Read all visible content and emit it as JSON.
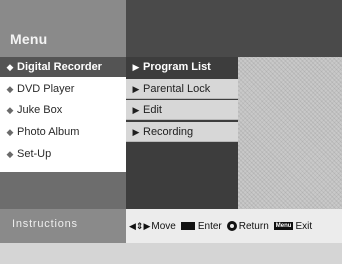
{
  "header": {
    "title": "Menu"
  },
  "main_menu": {
    "items": [
      {
        "label": "Digital Recorder",
        "selected": true
      },
      {
        "label": "DVD Player",
        "selected": false
      },
      {
        "label": "Juke Box",
        "selected": false
      },
      {
        "label": "Photo Album",
        "selected": false
      },
      {
        "label": "Set-Up",
        "selected": false
      }
    ]
  },
  "sub_menu": {
    "items": [
      {
        "label": "Program List",
        "selected": true
      },
      {
        "label": "Parental Lock",
        "selected": false
      },
      {
        "label": "Edit",
        "selected": false
      },
      {
        "label": "Recording",
        "selected": false
      }
    ]
  },
  "footer": {
    "instructions_label": "Instructions",
    "move_label": "Move",
    "enter_label": "Enter",
    "return_label": "Return",
    "menu_key_label": "Menu",
    "exit_label": "Exit"
  }
}
